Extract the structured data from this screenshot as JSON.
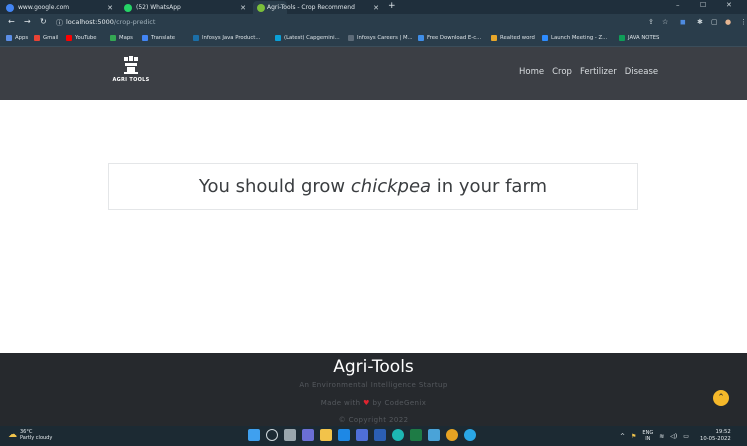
{
  "browser": {
    "tabs": [
      {
        "title": "www.google.com"
      },
      {
        "title": "(52) WhatsApp"
      },
      {
        "title": "Agri-Tools - Crop Recommend"
      }
    ],
    "url_host": "localhost:5000",
    "url_path": "/crop-predict",
    "bookmarks": [
      {
        "label": "Apps",
        "color": "#5b8ee6"
      },
      {
        "label": "Gmail",
        "color": "#e94335"
      },
      {
        "label": "YouTube",
        "color": "#ff0000"
      },
      {
        "label": "Maps",
        "color": "#34a853"
      },
      {
        "label": "Translate",
        "color": "#4285f4"
      },
      {
        "label": "Infosys Java Product...",
        "color": "#1b6fa8"
      },
      {
        "label": "(Latest) Capgemini...",
        "color": "#0aa0d8"
      },
      {
        "label": "Infosys Careers | M...",
        "color": "#5d6b78"
      },
      {
        "label": "Free Download E-c...",
        "color": "#3f8ee8"
      },
      {
        "label": "Realted word",
        "color": "#e8a72a"
      },
      {
        "label": "Launch Meeting - Z...",
        "color": "#2d8cff"
      },
      {
        "label": "JAVA NOTES",
        "color": "#0f9d58"
      }
    ]
  },
  "site": {
    "logo_text": "AGRI TOOLS",
    "nav": [
      "Home",
      "Crop",
      "Fertilizer",
      "Disease"
    ],
    "result_prefix": "You should grow ",
    "result_crop": "chickpea",
    "result_suffix": " in your farm",
    "footer": {
      "brand": "Agri-Tools",
      "tagline": "An Environmental Intelligence Startup",
      "made_prefix": "Made with",
      "made_suffix": "by CodeGenix",
      "copyright": "© Copyright 2022"
    },
    "accent": "#f5b82a"
  },
  "taskbar": {
    "temp": "36°C",
    "weather": "Partly cloudy",
    "lang": "ENG",
    "region": "IN",
    "time": "19:52",
    "date": "10-05-2022",
    "app_icons": [
      "windows-icon",
      "search-icon",
      "taskview-icon",
      "chat-icon",
      "explorer-icon",
      "mail-icon",
      "store-icon",
      "word-icon",
      "edge-icon",
      "excel-icon",
      "photos-icon",
      "chrome-icon",
      "skype-icon"
    ]
  }
}
